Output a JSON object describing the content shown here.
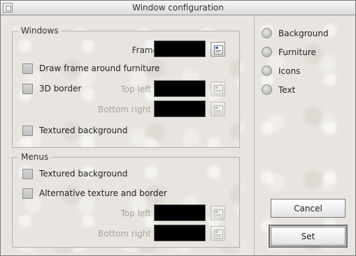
{
  "window": {
    "title": "Window configuration"
  },
  "windows_group": {
    "label": "Windows",
    "frame_label": "Frame",
    "frame_color": "#000000",
    "draw_frame_label": "Draw frame around furniture",
    "border_3d_label": "3D border",
    "top_left_label": "Top left",
    "bottom_right_label": "Bottom right",
    "textured_bg_label": "Textured background"
  },
  "menus_group": {
    "label": "Menus",
    "textured_bg_label": "Textured background",
    "alt_texture_label": "Alternative texture and border",
    "top_left_label": "Top left",
    "bottom_right_label": "Bottom right"
  },
  "options": {
    "items": [
      "Background",
      "Furniture",
      "Icons",
      "Text"
    ]
  },
  "buttons": {
    "cancel": "Cancel",
    "set": "Set"
  }
}
